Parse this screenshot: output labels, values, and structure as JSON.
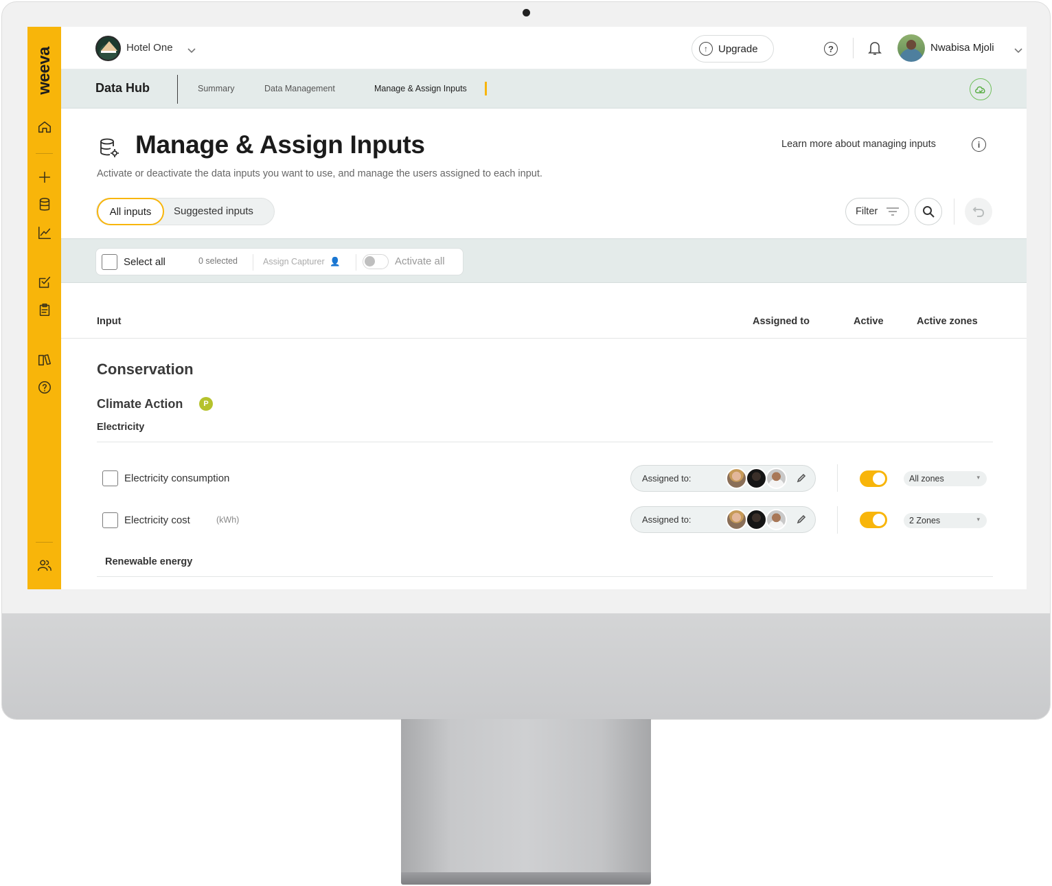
{
  "brand": {
    "logo_text": "weeva",
    "accent": "#f8b50a"
  },
  "sidebar": {
    "items": [
      {
        "name": "home",
        "icon": "home-icon"
      },
      {
        "name": "add",
        "icon": "plus-icon"
      },
      {
        "name": "data",
        "icon": "database-icon"
      },
      {
        "name": "analytics",
        "icon": "chart-icon"
      },
      {
        "name": "tasks",
        "icon": "checklist-icon"
      },
      {
        "name": "reports",
        "icon": "clipboard-icon"
      },
      {
        "name": "library",
        "icon": "book-icon"
      },
      {
        "name": "help",
        "icon": "help-icon"
      },
      {
        "name": "users",
        "icon": "users-icon"
      }
    ]
  },
  "topbar": {
    "hotel_name": "Hotel One",
    "upgrade_label": "Upgrade",
    "user_name": "Nwabisa Mjoli"
  },
  "subnav": {
    "title": "Data Hub",
    "tabs": [
      {
        "label": "Summary",
        "active": false
      },
      {
        "label": "Data Management",
        "active": false
      },
      {
        "label": "Manage & Assign Inputs",
        "active": true
      }
    ]
  },
  "page": {
    "title": "Manage & Assign Inputs",
    "learn_more": "Learn more about managing inputs",
    "subtitle": "Activate or deactivate the data inputs you want to use, and manage the users assigned to each input.",
    "segments": [
      "All inputs",
      "Suggested inputs"
    ],
    "filter_label": "Filter"
  },
  "bulk": {
    "select_all": "Select all",
    "selected_count": "0 selected",
    "assign_capturer": "Assign Capturer",
    "activate_all": "Activate all"
  },
  "table": {
    "headers": {
      "input": "Input",
      "assigned_to": "Assigned to",
      "active": "Active",
      "active_zones": "Active zones"
    },
    "section": "Conservation",
    "category": "Climate Action",
    "category_badge": "P",
    "group": "Electricity",
    "rows": [
      {
        "label": "Electricity consumption",
        "unit": "",
        "assigned_label": "Assigned to:",
        "active": true,
        "zones": "All zones"
      },
      {
        "label": "Electricity cost",
        "unit": "(kWh)",
        "assigned_label": "Assigned to:",
        "active": true,
        "zones": "2 Zones"
      }
    ],
    "next_group": "Renewable energy"
  }
}
